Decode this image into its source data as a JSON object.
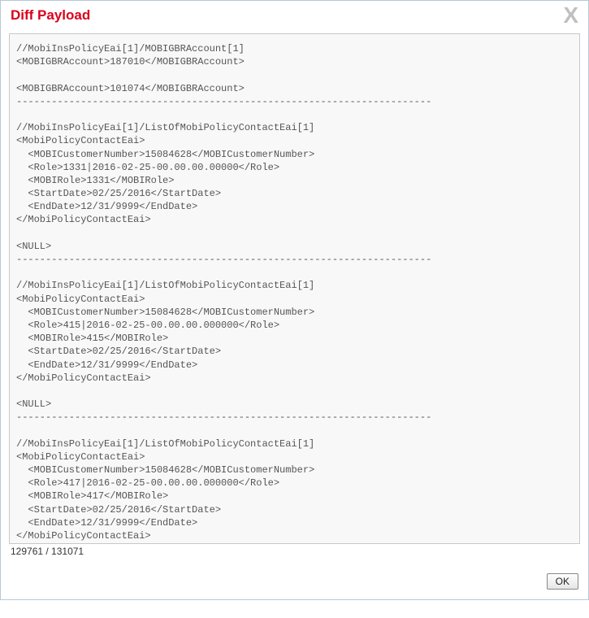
{
  "dialog": {
    "title": "Diff Payload",
    "close_symbol": "X",
    "counter": "129761 / 131071",
    "ok_label": "OK",
    "payload_text": "//MobiInsPolicyEai[1]/MOBIGBRAccount[1]\n<MOBIGBRAccount>187010</MOBIGBRAccount>\n\n<MOBIGBRAccount>101074</MOBIGBRAccount>\n-----------------------------------------------------------------------\n\n//MobiInsPolicyEai[1]/ListOfMobiPolicyContactEai[1]\n<MobiPolicyContactEai>\n  <MOBICustomerNumber>15084628</MOBICustomerNumber>\n  <Role>1331|2016-02-25-00.00.00.00000</Role>\n  <MOBIRole>1331</MOBIRole>\n  <StartDate>02/25/2016</StartDate>\n  <EndDate>12/31/9999</EndDate>\n</MobiPolicyContactEai>\n\n<NULL>\n-----------------------------------------------------------------------\n\n//MobiInsPolicyEai[1]/ListOfMobiPolicyContactEai[1]\n<MobiPolicyContactEai>\n  <MOBICustomerNumber>15084628</MOBICustomerNumber>\n  <Role>415|2016-02-25-00.00.00.000000</Role>\n  <MOBIRole>415</MOBIRole>\n  <StartDate>02/25/2016</StartDate>\n  <EndDate>12/31/9999</EndDate>\n</MobiPolicyContactEai>\n\n<NULL>\n-----------------------------------------------------------------------\n\n//MobiInsPolicyEai[1]/ListOfMobiPolicyContactEai[1]\n<MobiPolicyContactEai>\n  <MOBICustomerNumber>15084628</MOBICustomerNumber>\n  <Role>417|2016-02-25-00.00.00.000000</Role>\n  <MOBIRole>417</MOBIRole>\n  <StartDate>02/25/2016</StartDate>\n  <EndDate>12/31/9999</EndDate>\n</MobiPolicyContactEai>\n\n<NULL>\n-----------------------------------------------------------------------"
  }
}
